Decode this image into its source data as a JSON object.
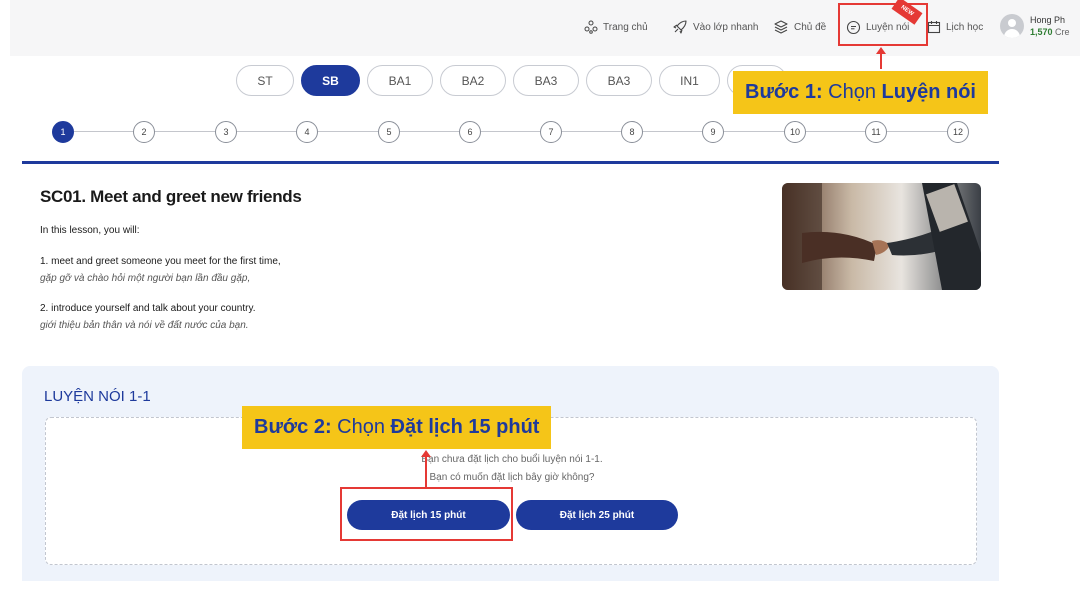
{
  "nav": {
    "home": "Trang chủ",
    "join_class": "Vào lớp nhanh",
    "topics": "Chủ đề",
    "speaking": "Luyện nói",
    "new_badge": "NEW",
    "schedule": "Lịch học",
    "user_name": "Hong Ph",
    "credits_value": "1,570",
    "credits_unit": "Cre"
  },
  "levels": [
    "ST",
    "SB",
    "BA1",
    "BA2",
    "BA3",
    "BA3",
    "IN1",
    ""
  ],
  "active_level": "SB",
  "steps": [
    "1",
    "2",
    "3",
    "4",
    "5",
    "6",
    "7",
    "8",
    "9",
    "10",
    "11",
    "12"
  ],
  "active_step": "1",
  "callout1": {
    "prefix": "Bước 1:",
    "verb": "Chọn",
    "target": "Luyện nói"
  },
  "callout2": {
    "prefix": "Bước 2:",
    "verb": "Chọn",
    "target": "Đặt lịch 15 phút"
  },
  "lesson": {
    "title": "SC01. Meet and greet new friends",
    "intro": "In this lesson, you will:",
    "objectives": [
      {
        "en": "1. meet and greet someone you meet for the first time,",
        "vi": "gặp gỡ và chào hỏi một người bạn lần đầu gặp,"
      },
      {
        "en": "2. introduce yourself and talk about your country.",
        "vi": "giới thiệu bản thân và nói về đất nước của bạn."
      }
    ]
  },
  "speaking": {
    "title": "LUYỆN NÓI 1-1",
    "message_line1": "Bạn chưa đặt lịch cho buổi luyện nói 1-1.",
    "message_line2": "Bạn có muốn đặt lịch bây giờ không?",
    "book15": "Đặt lịch 15 phút",
    "book25": "Đặt lịch 25 phút"
  },
  "colors": {
    "primary": "#1e3a9c",
    "callout_bg": "#f5c518",
    "highlight": "#e53935"
  }
}
